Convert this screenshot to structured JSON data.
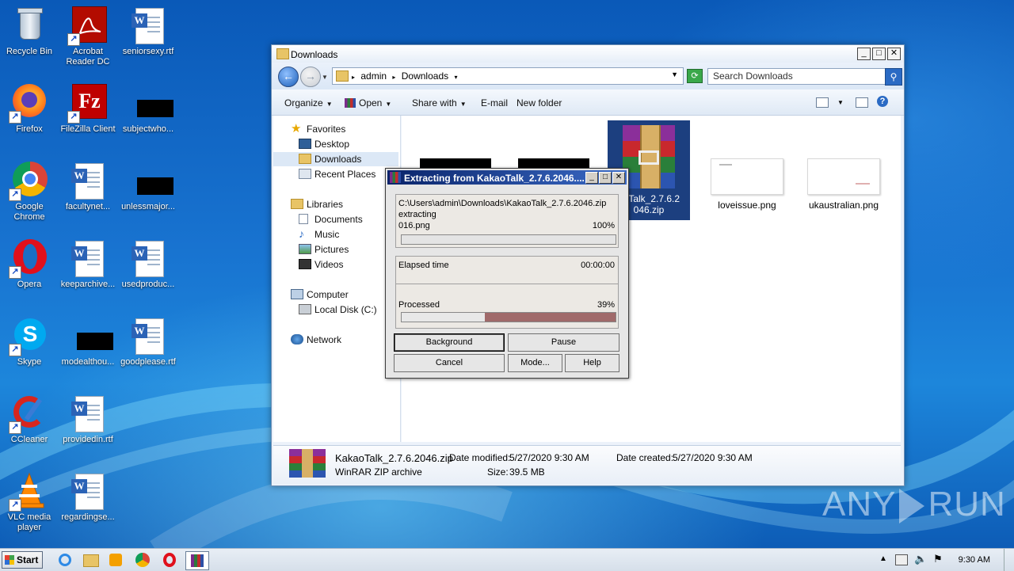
{
  "desktop": {
    "icons": [
      {
        "label": "Recycle Bin"
      },
      {
        "label": "Acrobat\nReader DC"
      },
      {
        "label": "seniorsexy.rtf"
      },
      {
        "label": "Firefox"
      },
      {
        "label": "FileZilla Client"
      },
      {
        "label": "subjectwho..."
      },
      {
        "label": "Google\nChrome"
      },
      {
        "label": "facultynet..."
      },
      {
        "label": "unlessmajor..."
      },
      {
        "label": "Opera"
      },
      {
        "label": "keeparchive..."
      },
      {
        "label": "usedproduc..."
      },
      {
        "label": "Skype"
      },
      {
        "label": "modealthou..."
      },
      {
        "label": "goodplease.rtf"
      },
      {
        "label": "CCleaner"
      },
      {
        "label": "providedin.rtf"
      },
      {
        "label": "VLC media\nplayer"
      },
      {
        "label": "regardingse..."
      }
    ]
  },
  "explorer": {
    "title": "Downloads",
    "breadcrumbs": [
      "admin",
      "Downloads"
    ],
    "search_placeholder": "Search Downloads",
    "toolbar": {
      "organize": "Organize",
      "open": "Open",
      "share_with": "Share with",
      "email": "E-mail",
      "new_folder": "New folder"
    },
    "nav": {
      "favorites": "Favorites",
      "desktop": "Desktop",
      "downloads": "Downloads",
      "recent_places": "Recent Places",
      "libraries": "Libraries",
      "documents": "Documents",
      "music": "Music",
      "pictures": "Pictures",
      "videos": "Videos",
      "computer": "Computer",
      "local_disk": "Local Disk (C:)",
      "network": "Network"
    },
    "files": [
      {
        "name": ""
      },
      {
        "name": ""
      },
      {
        "name": "KakaoTalk_2.7.6.2046.zip",
        "display": "aoTalk_2.7.6.2\n046.zip"
      },
      {
        "name": "loveissue.png"
      },
      {
        "name": "ukaustralian.png"
      }
    ],
    "details": {
      "filename": "KakaoTalk_2.7.6.2046.zip",
      "type": "WinRAR ZIP archive",
      "date_modified_label": "Date modified:",
      "date_modified": "5/27/2020 9:30 AM",
      "date_created_label": "Date created:",
      "date_created": "5/27/2020 9:30 AM",
      "size_label": "Size:",
      "size": "39.5 MB"
    }
  },
  "rar_dialog": {
    "title": "Extracting from KakaoTalk_2.7.6.2046....",
    "path": "C:\\Users\\admin\\Downloads\\KakaoTalk_2.7.6.2046.zip",
    "action": "extracting",
    "current_file": "016.png",
    "file_percent": "100%",
    "file_progress": 1.0,
    "elapsed_label": "Elapsed time",
    "elapsed_value": "00:00:00",
    "processed_label": "Processed",
    "processed_percent": "39%",
    "processed_progress": 0.39,
    "buttons": {
      "background": "Background",
      "pause": "Pause",
      "cancel": "Cancel",
      "mode": "Mode...",
      "help": "Help"
    }
  },
  "taskbar": {
    "start": "Start",
    "clock": "9:30 AM"
  },
  "watermark": {
    "left": "ANY",
    "right": "RUN"
  },
  "colors": {
    "desktop_bg": "#1a6fc4",
    "progress_fill": "#a06a6a",
    "rar_title": "#0a246a"
  }
}
